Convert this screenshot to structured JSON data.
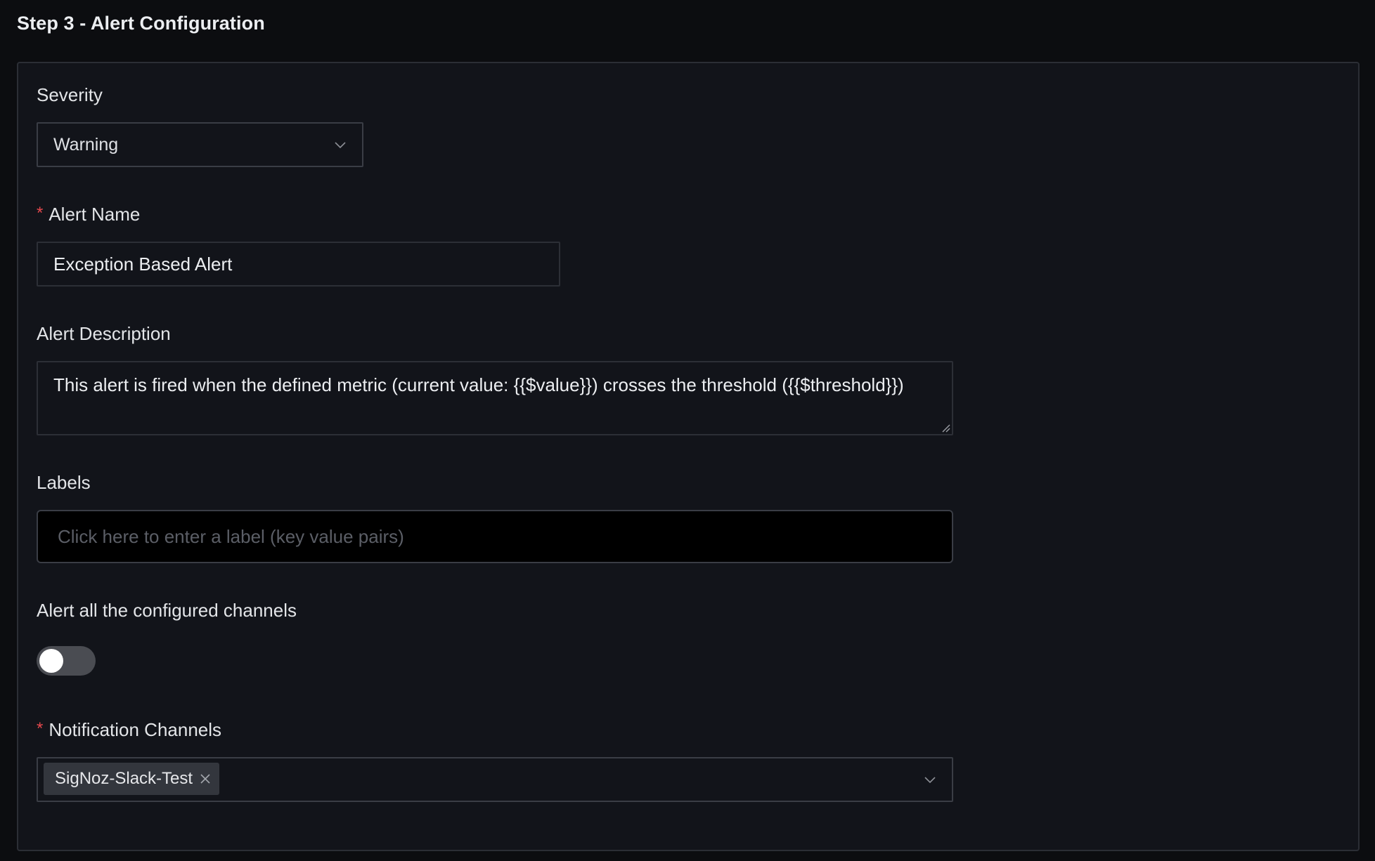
{
  "step_title": "Step 3 - Alert Configuration",
  "severity": {
    "label": "Severity",
    "value": "Warning"
  },
  "alert_name": {
    "required_mark": "*",
    "label": "Alert Name",
    "value": "Exception Based Alert"
  },
  "alert_description": {
    "label": "Alert Description",
    "value": "This alert is fired when the defined metric (current value: {{$value}}) crosses the threshold ({{$threshold}})"
  },
  "labels": {
    "label": "Labels",
    "placeholder": "Click here to enter a label (key value pairs)"
  },
  "alert_all_channels": {
    "label": "Alert all the configured channels",
    "enabled": false
  },
  "notification_channels": {
    "required_mark": "*",
    "label": "Notification Channels",
    "selected": [
      "SigNoz-Slack-Test"
    ]
  },
  "colors": {
    "background": "#0c0d10",
    "panel": "#12141a",
    "required": "#e5484d",
    "toggle_off": "#4a4c52"
  }
}
